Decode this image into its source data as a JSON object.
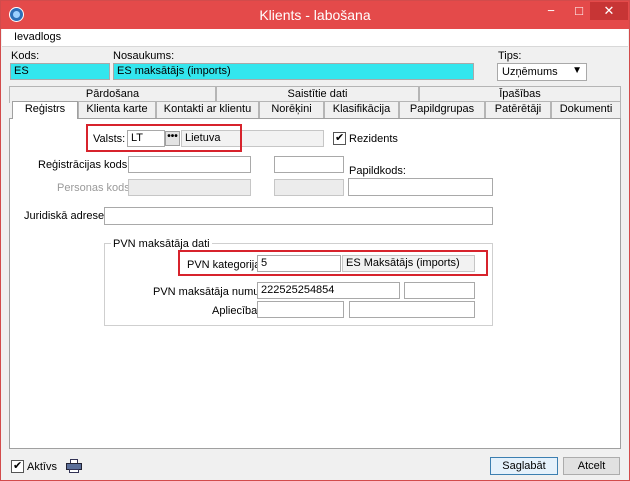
{
  "window": {
    "title": "Klients - labošana",
    "min": "−",
    "max": "□",
    "close": "✕"
  },
  "menu": {
    "item": "Ievadlogs"
  },
  "header": {
    "kods_label": "Kods:",
    "kods_value": "ES",
    "nosaukums_label": "Nosaukums:",
    "nosaukums_value": "ES maksātājs (imports)",
    "tips_label": "Tips:",
    "tips_value": "Uzņēmums"
  },
  "tabs": {
    "row1": [
      "Pārdošana",
      "Saistītie dati",
      "Īpašības"
    ],
    "row2": [
      "Reģistrs",
      "Klienta karte",
      "Kontakti ar klientu",
      "Norēķini",
      "Klasifikācija",
      "Papildgrupas",
      "Patērētāji",
      "Dokumenti"
    ]
  },
  "form": {
    "valsts_label": "Valsts:",
    "valsts_code": "LT",
    "valsts_name": "Lietuva",
    "dots": "•••",
    "rezidents_label": "Rezidents",
    "reg_kods_label": "Reģistrācijas kods:",
    "personas_kods_label": "Personas kods:",
    "papildkods_label": "Papildkods:",
    "juridiska_label": "Juridiskā adrese:"
  },
  "pvn": {
    "group_title": "PVN maksātāja dati",
    "kategorija_label": "PVN kategorija:",
    "kategorija_value": "5",
    "kategorija_name": "ES Maksātājs (imports)",
    "numurs_label": "PVN maksātāja numurs:",
    "numurs_value": "222525254854",
    "apliecibas_label": "Apliecība:"
  },
  "footer": {
    "aktivs_label": "Aktīvs",
    "save_label": "Saglabāt",
    "cancel_label": "Atcelt"
  }
}
